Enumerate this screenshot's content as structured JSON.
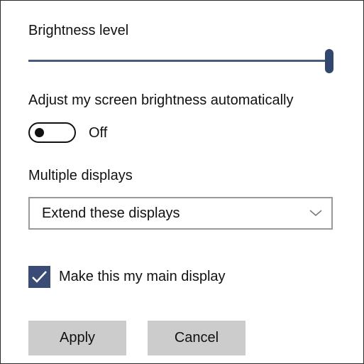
{
  "brightness": {
    "label": "Brightness level",
    "value_percent": 100
  },
  "auto_brightness": {
    "label": "Adjust my screen brightness automatically",
    "state_label": "Off",
    "on": false
  },
  "multiple_displays": {
    "label": "Multiple displays",
    "selected": "Extend these displays",
    "icon": "chevron-down-icon"
  },
  "main_display": {
    "label": "Make this my main display",
    "checked": true,
    "icon": "checkmark-icon"
  },
  "actions": {
    "apply_label": "Apply",
    "cancel_label": "Cancel"
  },
  "colors": {
    "accent": "#3a4c76",
    "button_bg": "#cccccc",
    "dropdown_border": "#999999"
  }
}
